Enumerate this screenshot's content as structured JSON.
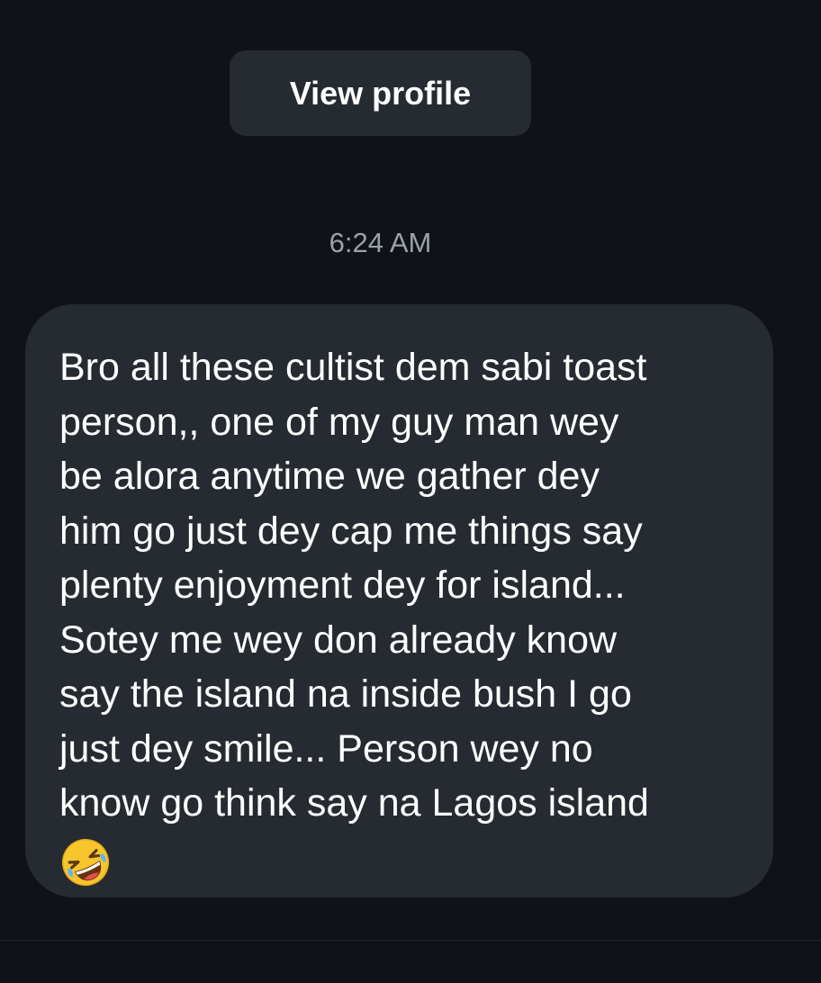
{
  "header": {
    "view_profile_label": "View profile"
  },
  "conversation": {
    "timestamp": "6:24 AM",
    "message": {
      "lines": [
        "Bro all these cultist dem sabi toast",
        "person,, one of my guy man wey",
        "be alora anytime we gather dey",
        "him go just dey cap me things say",
        "plenty enjoyment dey for island...",
        "Sotey me wey don already know",
        "say the island na inside bush I go",
        "just dey smile... Person wey no",
        "know go think say na Lagos island"
      ],
      "emoji": "rolling-on-the-floor-laughing-emoji"
    }
  },
  "colors": {
    "background": "#0f1318",
    "bubble": "#262b31",
    "timestamp_text": "#9aa1aa",
    "text": "#ffffff"
  }
}
